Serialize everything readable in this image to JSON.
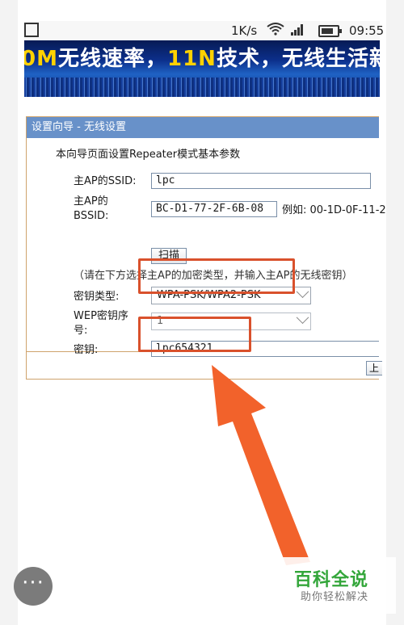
{
  "status_bar": {
    "net_rate": "1K/s",
    "time": "09:55",
    "icons": [
      "screenshot-icon",
      "wifi-icon",
      "signal-icon",
      "battery-icon"
    ]
  },
  "banner": {
    "text_lead": "0M",
    "text_mid": "无线速率，",
    "text_hl": "11N",
    "text_tail": "技术，无线生活新"
  },
  "wizard": {
    "title": "设置向导 - 无线设置",
    "intro": "本向导页面设置Repeater模式基本参数",
    "ssid_label": "主AP的SSID:",
    "ssid_value": "lpc",
    "bssid_label_1": "主AP的",
    "bssid_label_2": "BSSID:",
    "bssid_value": "BC-D1-77-2F-6B-08",
    "bssid_example": "例如: 00-1D-0F-11-2",
    "scan_label": "扫描",
    "hint": "（请在下方选择主AP的加密类型，并输入主AP的无线密钥）",
    "key_type_label": "密钥类型:",
    "key_type_value": "WPA-PSK/WPA2-PSK",
    "wep_index_label_1": "WEP密钥序",
    "wep_index_label_2": "号:",
    "wep_index_value": "1",
    "key_label": "密钥:",
    "key_value": "lpc654321",
    "next_label": "上"
  },
  "fab": {
    "label": "···"
  },
  "watermark": {
    "logo": "百科全说",
    "sub": "助你轻松解决"
  },
  "colors": {
    "highlight_red": "#d9512c",
    "arrow_orange": "#f2622b",
    "panel_header": "#6891c9",
    "panel_border": "#cfa36c",
    "watermark_green": "#33a63a"
  }
}
